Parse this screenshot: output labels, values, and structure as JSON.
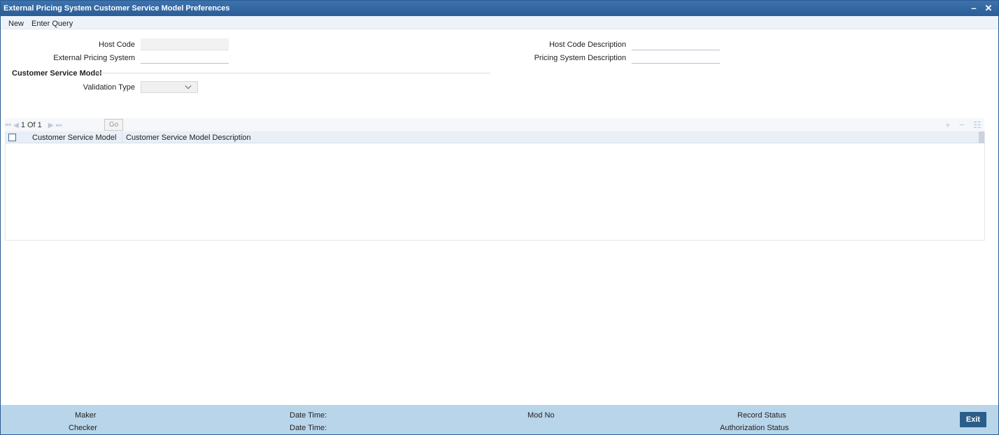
{
  "window": {
    "title": "External Pricing System Customer Service Model Preferences",
    "minimize_label": "–",
    "close_label": "✕"
  },
  "menu": {
    "new_label": "New",
    "enter_query_label": "Enter Query"
  },
  "form": {
    "host_code_label": "Host Code",
    "host_code_value": "",
    "external_pricing_system_label": "External Pricing System",
    "external_pricing_system_value": "",
    "host_code_description_label": "Host Code Description",
    "host_code_description_value": "",
    "pricing_system_description_label": "Pricing System Description",
    "pricing_system_description_value": "",
    "section_title": "Customer Service Model",
    "validation_type_label": "Validation Type",
    "validation_type_value": ""
  },
  "grid": {
    "pager_text": "1 Of 1",
    "go_label": "Go",
    "columns": [
      "Customer Service Model",
      "Customer Service Model Description"
    ],
    "rows": []
  },
  "footer": {
    "maker_label": "Maker",
    "checker_label": "Checker",
    "date_time_label_1": "Date Time:",
    "date_time_label_2": "Date Time:",
    "mod_no_label": "Mod No",
    "record_status_label": "Record Status",
    "authorization_status_label": "Authorization Status",
    "exit_label": "Exit"
  }
}
